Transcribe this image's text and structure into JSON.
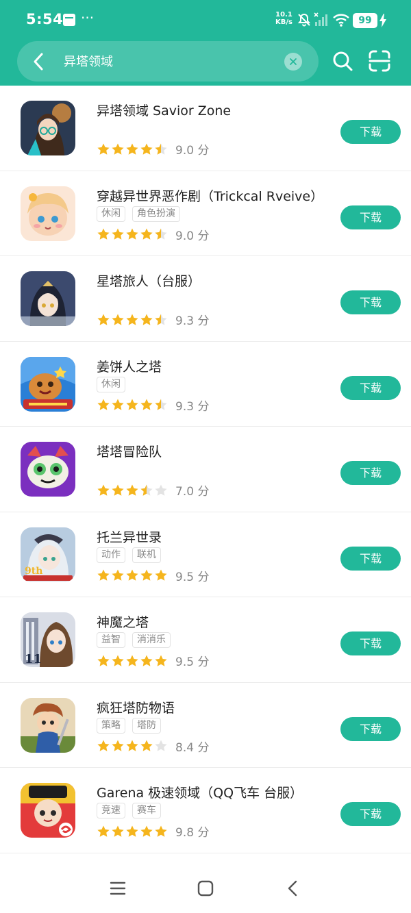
{
  "status": {
    "time": "5:54",
    "more": "···",
    "net_rate": "10.1",
    "net_unit": "KB/s",
    "battery": "99"
  },
  "search": {
    "query": "异塔领域"
  },
  "colors": {
    "brand": "#22b89a",
    "star_on": "#f5b51d",
    "star_off": "#e3e3e3"
  },
  "apps": [
    {
      "name": "异塔领域 Savior Zone",
      "tags": [],
      "rating": 4.5,
      "score": "9.0 分",
      "button": "下载",
      "icon": "savior-zone-icon"
    },
    {
      "name": "穿越异世界恶作剧（Trickcal Rveive）",
      "tags": [
        "休闲",
        "角色扮演"
      ],
      "rating": 4.5,
      "score": "9.0 分",
      "button": "下载",
      "icon": "trickcal-icon"
    },
    {
      "name": "星塔旅人（台服）",
      "tags": [],
      "rating": 4.5,
      "score": "9.3 分",
      "button": "下载",
      "icon": "star-tower-icon"
    },
    {
      "name": "姜饼人之塔",
      "tags": [
        "休闲"
      ],
      "rating": 4.5,
      "score": "9.3 分",
      "button": "下载",
      "icon": "cookie-run-icon"
    },
    {
      "name": "塔塔冒险队",
      "tags": [],
      "rating": 3.5,
      "score": "7.0 分",
      "button": "下载",
      "icon": "tata-icon"
    },
    {
      "name": "托兰异世录",
      "tags": [
        "动作",
        "联机"
      ],
      "rating": 5,
      "score": "9.5 分",
      "button": "下载",
      "icon": "toram-icon"
    },
    {
      "name": "神魔之塔",
      "tags": [
        "益智",
        "消消乐"
      ],
      "rating": 5,
      "score": "9.5 分",
      "button": "下载",
      "icon": "tower-of-saviors-icon"
    },
    {
      "name": "疯狂塔防物语",
      "tags": [
        "策略",
        "塔防"
      ],
      "rating": 4,
      "score": "8.4 分",
      "button": "下载",
      "icon": "tower-defense-icon"
    },
    {
      "name": "Garena 极速领域（QQ飞车 台服）",
      "tags": [
        "竞速",
        "赛车"
      ],
      "rating": 5,
      "score": "9.8 分",
      "button": "下载",
      "icon": "garena-speed-icon"
    }
  ]
}
